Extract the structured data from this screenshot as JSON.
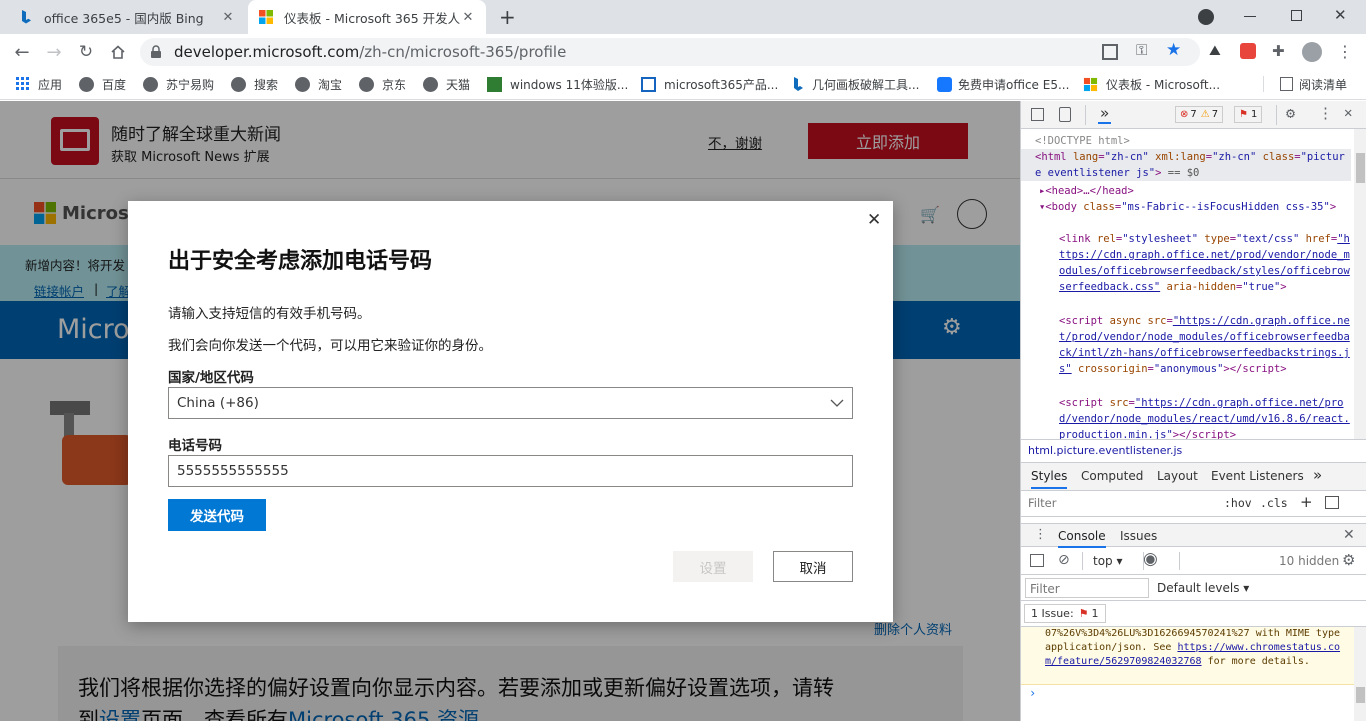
{
  "tabs": [
    {
      "title": "office 365e5 - 国内版 Bing",
      "close": "✕"
    },
    {
      "title": "仪表板 - Microsoft 365 开发人员",
      "close": "✕"
    }
  ],
  "new_tab": "+",
  "address": {
    "host": "developer.microsoft.com",
    "path": "/zh-cn/microsoft-365/profile"
  },
  "bookmarks": [
    "应用",
    "百度",
    "苏宁易购",
    "搜索",
    "淘宝",
    "京东",
    "天猫",
    "windows 11体验版...",
    "microsoft365产品...",
    "几何画板破解工具...",
    "免费申请office E5...",
    "仪表板 - Microsoft...",
    "阅读清单"
  ],
  "news_banner": {
    "title": "随时了解全球重大新闻",
    "subtitle": "获取 Microsoft News 扩展",
    "dismiss": "不，谢谢",
    "add": "立即添加"
  },
  "site": {
    "logo": "Microsoft",
    "notice_line": "新增内容！将开发",
    "link1": "链接帐户",
    "sep": "|",
    "link2": "了解",
    "hero": "Micro",
    "delete_profile": "删除个人资料",
    "pref_text": "我们将根据你选择的偏好设置向你显示内容。若要添加或更新偏好设置选项，请转",
    "pref_text2a": "到",
    "pref_link1": "设置",
    "pref_text2b": "页面。查看所有",
    "pref_link2": "Microsoft 365 资源"
  },
  "dialog": {
    "title": "出于安全考虑添加电话号码",
    "desc1": "请输入支持短信的有效手机号码。",
    "desc2": "我们会向你发送一个代码，可以用它来验证你的身份。",
    "country_label": "国家/地区代码",
    "country_value": "China (+86)",
    "phone_label": "电话号码",
    "phone_value": "5555555555555",
    "send_code": "发送代码",
    "set": "设置",
    "cancel": "取消",
    "close": "✕"
  },
  "devtools": {
    "more_tabs": "»",
    "errors": "7",
    "warnings": "7",
    "issues_badge": "1",
    "doctype": "<!DOCTYPE html>",
    "selected_suffix": "== $0",
    "breadcrumb": "html.picture.eventlistener.js",
    "style_tabs": [
      "Styles",
      "Computed",
      "Layout",
      "Event Listeners"
    ],
    "filter": "Filter",
    "hov": ":hov",
    "cls": ".cls",
    "console_tabs": [
      "Console",
      "Issues"
    ],
    "context": "top",
    "hidden": "10 hidden",
    "console_filter": "Filter",
    "levels": "Default levels",
    "issue_label": "1 Issue:",
    "issue_count": "1",
    "msg_a": "07%26V%3D4%26LU%3D1626694570241%27",
    "msg_b": " with MIME type application/json. See ",
    "msg_link": "https://www.chromestatus.com/feature/5629709824032768",
    "msg_c": " for more details."
  }
}
